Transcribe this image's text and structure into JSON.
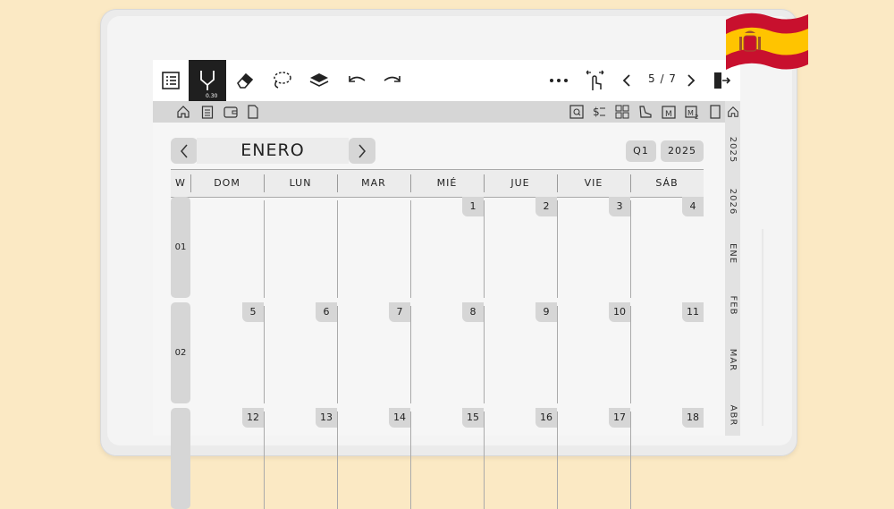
{
  "toolbar": {
    "pen_size": "0.30",
    "page_indicator": "5 / 7"
  },
  "calendar": {
    "month": "ENERO",
    "quarter": "Q1",
    "year": "2025",
    "week_label": "W",
    "days": [
      "DOM",
      "LUN",
      "MAR",
      "MIÉ",
      "JUE",
      "VIE",
      "SÁB"
    ],
    "weeks": [
      {
        "num": "01",
        "dates": [
          "",
          "",
          "",
          "1",
          "2",
          "3",
          "4"
        ]
      },
      {
        "num": "02",
        "dates": [
          "5",
          "6",
          "7",
          "8",
          "9",
          "10",
          "11"
        ]
      },
      {
        "num": "",
        "dates": [
          "12",
          "13",
          "14",
          "15",
          "16",
          "17",
          "18"
        ]
      }
    ]
  },
  "side_tabs": [
    "2025",
    "2026",
    "ENE",
    "FEB",
    "MAR",
    "ABR"
  ],
  "colors": {
    "background": "#fbe9c4",
    "flag_red": "#c8102e",
    "flag_yellow": "#ffc400"
  }
}
